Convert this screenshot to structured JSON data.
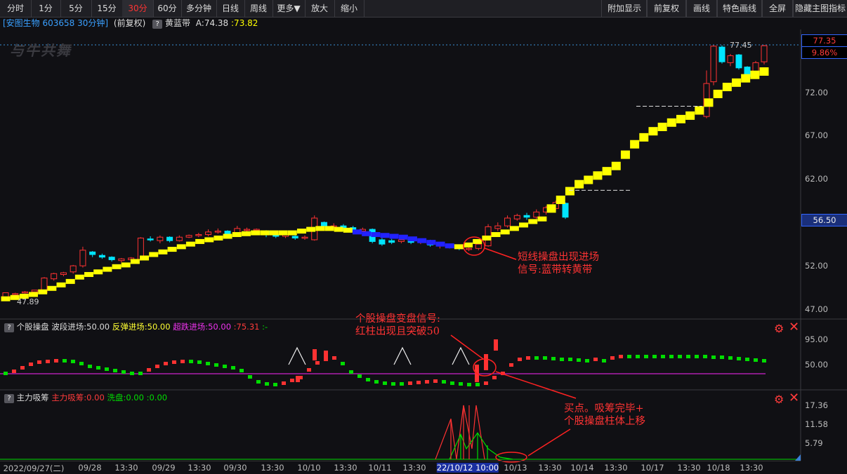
{
  "toolbar": {
    "left": [
      "分时",
      "1分",
      "5分",
      "15分",
      "30分",
      "60分",
      "多分钟",
      "日线",
      "周线",
      "更多▼",
      "放大",
      "缩小"
    ],
    "active": "30分",
    "right": [
      "附加显示",
      "前复权",
      "画线",
      "特色画线",
      "全屏",
      "隐藏主图指标"
    ]
  },
  "info": {
    "stock": "[安图生物 603658 30分钟]",
    "adj": "(前复权)",
    "qmark": "?",
    "indicator_name": "黄蓝带",
    "a_label": "A:74.38",
    "b_label": ":73.82"
  },
  "watermark": "与牛共舞",
  "price_axis": {
    "ticks": [
      "77.35",
      "72.00",
      "67.00",
      "62.00",
      "56.50",
      "52.00",
      "47.00"
    ],
    "high_label": "77.45",
    "low_label": "47.89",
    "last_price": "77.35",
    "last_pct": "9.86%",
    "cursor_price": "56.50"
  },
  "panel2": {
    "name": "个股操盘",
    "f1": "波段进场:50.00",
    "f2": "反弹进场:50.00",
    "f3": "超跌进场:50.00",
    "f4": ":75.31",
    "f5": ":-",
    "ticks": [
      "95.00",
      "50.00"
    ]
  },
  "panel3": {
    "name": "主力吸筹",
    "f1": "主力吸筹:0.00",
    "f2": "洗盘:0.00",
    "f3": ":0.00",
    "ticks": [
      "17.36",
      "11.58",
      "5.79"
    ]
  },
  "annotations": {
    "a1_line1": "短线操盘出现进场",
    "a1_line2": "信号:蓝带转黄带",
    "a2_line1": "个股操盘变盘信号:",
    "a2_line2": "红柱出现且突破50",
    "a3_line1": "买点。吸筹完毕+",
    "a3_line2": "个股操盘柱体上移"
  },
  "dates": [
    "2022/09/27(二)",
    "09/28",
    "13:30",
    "09/29",
    "13:30",
    "09/30",
    "13:30",
    "10/10",
    "13:30",
    "10/11",
    "13:30",
    "22/10/12 10:00",
    "10/13",
    "13:30",
    "10/14",
    "13:30",
    "10/17",
    "13:30",
    "10/18",
    "13:30"
  ],
  "icons": {
    "settings": "gear-icon",
    "close": "close-icon",
    "corner": "triangle-icon"
  },
  "colors": {
    "up": "#ff3232",
    "down": "#00e5ff",
    "band_yellow": "#ffff00",
    "band_blue": "#2222ff",
    "green": "#00dd00",
    "magenta": "#cc22cc"
  },
  "chart_data": [
    {
      "type": "candlestick",
      "title": "安图生物 603658 30分钟",
      "ylim": [
        47,
        77.45
      ],
      "price_bars": [
        [
          48.3,
          48.9,
          48.0,
          48.6
        ],
        [
          48.7,
          48.8,
          48.5,
          48.9
        ],
        [
          48.9,
          49.0,
          48.8,
          49.1
        ],
        [
          49.0,
          49.2,
          48.9,
          49.0
        ],
        [
          48.9,
          50.6,
          48.8,
          50.7
        ],
        [
          50.5,
          51.1,
          50.3,
          51.2
        ],
        [
          51.0,
          51.2,
          50.8,
          51.3
        ],
        [
          51.3,
          52.0,
          51.1,
          52.1
        ],
        [
          52.0,
          53.8,
          51.8,
          54.2
        ],
        [
          53.6,
          53.3,
          53.0,
          53.7
        ],
        [
          53.2,
          53.0,
          52.8,
          53.4
        ],
        [
          53.0,
          52.7,
          52.5,
          53.1
        ],
        [
          52.6,
          52.8,
          52.4,
          52.9
        ],
        [
          52.7,
          52.9,
          52.5,
          53.0
        ],
        [
          52.7,
          55.2,
          52.6,
          55.3
        ],
        [
          55.1,
          55.0,
          54.8,
          55.4
        ],
        [
          54.9,
          55.3,
          54.6,
          55.5
        ],
        [
          55.3,
          54.9,
          54.7,
          55.4
        ],
        [
          54.9,
          55.3,
          54.8,
          55.5
        ],
        [
          55.3,
          55.5,
          55.2,
          55.6
        ],
        [
          55.5,
          55.6,
          55.3,
          55.8
        ],
        [
          55.6,
          55.9,
          55.4,
          56.2
        ],
        [
          55.9,
          56.0,
          55.7,
          56.3
        ],
        [
          56.0,
          55.7,
          55.5,
          56.1
        ],
        [
          55.5,
          56.3,
          55.4,
          56.6
        ],
        [
          56.1,
          56.2,
          55.8,
          56.4
        ],
        [
          56.2,
          56.2,
          56.0,
          56.3
        ],
        [
          56.0,
          55.6,
          55.3,
          56.1
        ],
        [
          55.6,
          55.4,
          55.2,
          55.7
        ],
        [
          55.4,
          55.6,
          55.2,
          55.8
        ],
        [
          55.4,
          55.2,
          55.0,
          55.6
        ],
        [
          55.2,
          55.3,
          55.0,
          55.5
        ],
        [
          55.0,
          57.5,
          54.9,
          57.8
        ],
        [
          57.0,
          56.6,
          56.3,
          57.1
        ],
        [
          56.6,
          56.6,
          56.3,
          56.9
        ],
        [
          56.6,
          56.3,
          56.0,
          56.8
        ],
        [
          56.4,
          56.0,
          55.8,
          56.6
        ],
        [
          56.0,
          56.2,
          55.7,
          56.4
        ],
        [
          56.2,
          54.8,
          54.6,
          56.3
        ],
        [
          55.0,
          54.5,
          54.3,
          55.2
        ],
        [
          54.9,
          54.7,
          54.5,
          55.1
        ],
        [
          54.8,
          55.0,
          54.6,
          55.2
        ],
        [
          55.0,
          54.7,
          54.5,
          55.2
        ],
        [
          54.8,
          55.0,
          54.5,
          55.1
        ],
        [
          54.9,
          54.4,
          54.2,
          55.0
        ],
        [
          54.4,
          54.5,
          54.0,
          54.6
        ],
        [
          54.3,
          54.2,
          54.0,
          54.5
        ],
        [
          54.2,
          54.0,
          53.8,
          54.3
        ],
        [
          53.9,
          54.0,
          53.7,
          54.1
        ],
        [
          54.0,
          54.5,
          53.8,
          54.7
        ],
        [
          54.3,
          56.5,
          54.2,
          56.8
        ],
        [
          56.3,
          56.6,
          56.0,
          57.0
        ],
        [
          56.6,
          57.5,
          56.4,
          57.8
        ],
        [
          57.4,
          57.8,
          57.2,
          58.0
        ],
        [
          57.8,
          57.6,
          57.3,
          58.1
        ],
        [
          57.6,
          58.2,
          57.4,
          58.5
        ],
        [
          58.2,
          58.7,
          57.9,
          58.9
        ],
        [
          58.6,
          59.3,
          58.4,
          59.5
        ],
        [
          59.2,
          57.6,
          57.4,
          59.3
        ]
      ],
      "price_bars_columns": [
        "open",
        "close",
        "low",
        "high"
      ],
      "series": [
        {
          "name": "A",
          "values": [
            48.2,
            48.35,
            48.5,
            48.7,
            49.0,
            49.4,
            49.8,
            50.2,
            50.7,
            51.0,
            51.3,
            51.6,
            51.9,
            52.1,
            52.5,
            52.9,
            53.3,
            53.6,
            53.9,
            54.2,
            54.5,
            54.8,
            55.0,
            55.2,
            55.4,
            55.6,
            55.7,
            55.8,
            55.8,
            55.8,
            55.8,
            55.8,
            56.0,
            56.2,
            56.3,
            56.3,
            56.2,
            56.1,
            55.9,
            55.7,
            55.6,
            55.5,
            55.4,
            55.3,
            55.1,
            54.9,
            54.7,
            54.5,
            54.3,
            54.2,
            54.4,
            54.8,
            55.2,
            55.6,
            55.9,
            56.3,
            56.7,
            57.1,
            57.4,
            58.6,
            59.6,
            60.6,
            61.4,
            61.9,
            62.4,
            62.9,
            63.5,
            64.8,
            66.0,
            66.8,
            67.5,
            68.0,
            68.5,
            68.9,
            69.3,
            69.9,
            70.8,
            71.8,
            72.6,
            73.1,
            73.6,
            74.0,
            74.38
          ],
          "color": "#ffff00"
        }
      ],
      "segment_colors": "yellow band except blue segment around 10/11"
    },
    {
      "type": "bar",
      "title": "个股操盘",
      "ylim": [
        35,
        105
      ],
      "ticks": [
        95,
        50
      ],
      "values": [
        50,
        53,
        58,
        63,
        66,
        67,
        68,
        68,
        67,
        64,
        60,
        58,
        56,
        54,
        52,
        50,
        50,
        55,
        60,
        64,
        66,
        67,
        67,
        66,
        64,
        62,
        60,
        58,
        54,
        45,
        38,
        35,
        34,
        36,
        40,
        44,
        55,
        65,
        70,
        72,
        64,
        52,
        46,
        41,
        38,
        36,
        35,
        35,
        36,
        37,
        38,
        39,
        38,
        36,
        35,
        34,
        34,
        36,
        44,
        50,
        62,
        70,
        72,
        72,
        72,
        71,
        70,
        70,
        69,
        68,
        70,
        68,
        72,
        74,
        74,
        74,
        74,
        74,
        74,
        74,
        74,
        74,
        74,
        74,
        73,
        73,
        72,
        71,
        70,
        69,
        68
      ],
      "red_ranges": "rising",
      "marker_level": 50
    },
    {
      "type": "area",
      "title": "主力吸筹",
      "ylim": [
        0,
        17.36
      ],
      "ticks": [
        17.36,
        11.58,
        5.79
      ],
      "red_spikes": [
        {
          "x": 54,
          "value": 13.0
        },
        {
          "x": 55,
          "value": 17.36
        },
        {
          "x": 57,
          "value": 17.36
        }
      ],
      "green_spikes": [
        {
          "x": 56,
          "value": 8.0
        },
        {
          "x": 58,
          "value": 8.5
        },
        {
          "x": 59,
          "value": 4.5
        }
      ]
    }
  ]
}
